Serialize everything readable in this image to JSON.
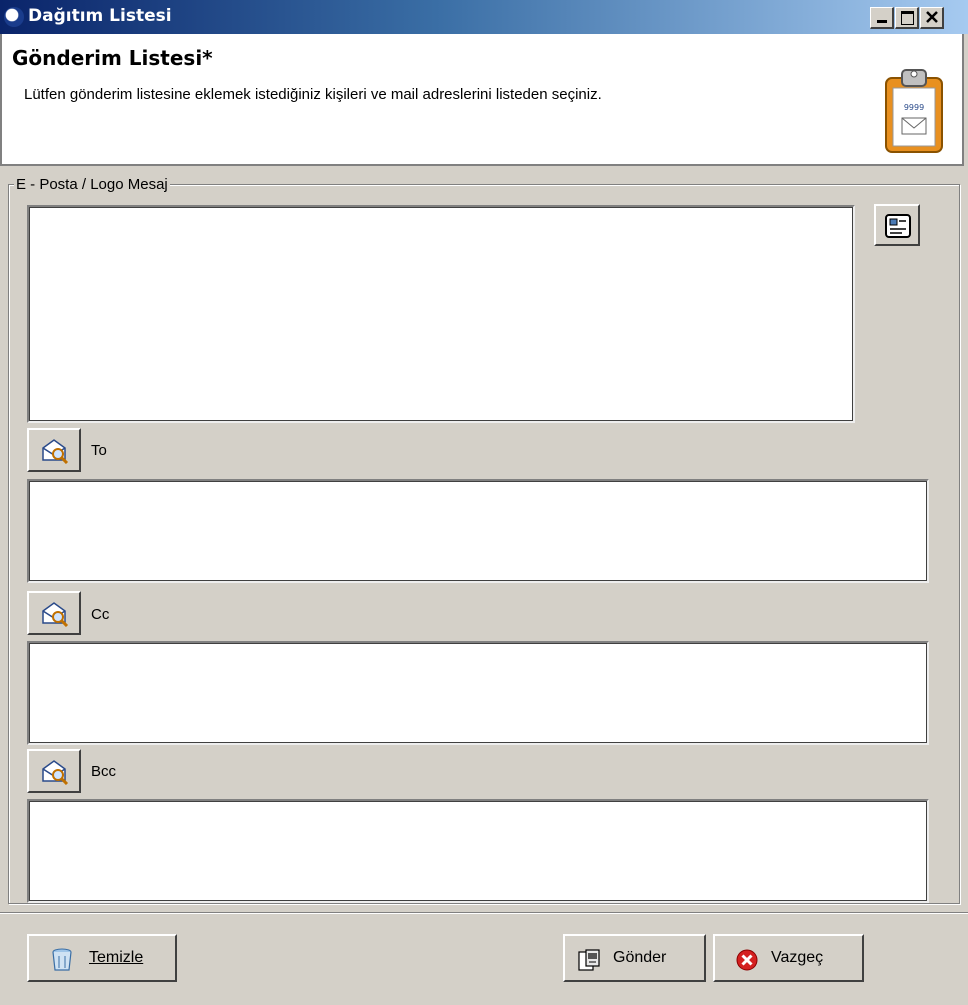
{
  "window": {
    "title": "Dağıtım Listesi"
  },
  "header": {
    "title": "Gönderim Listesi*",
    "subtitle": "Lütfen gönderim listesine eklemek istediğiniz kişileri ve mail adreslerini  listeden seçiniz."
  },
  "group": {
    "legend": "E - Posta / Logo Mesaj"
  },
  "fields": {
    "message": "",
    "to_label": "To",
    "to": "",
    "cc_label": "Cc",
    "cc": "",
    "bcc_label": "Bcc",
    "bcc": ""
  },
  "footer": {
    "clear_label": "Temizle",
    "send_label": "Gönder",
    "cancel_label": "Vazgeç"
  },
  "icons": {
    "window": "app-eye-icon",
    "header": "clipboard-mail-icon",
    "template": "template-document-icon",
    "address_book": "address-book-search-icon",
    "clear": "recycle-bin-icon",
    "send": "send-document-icon",
    "cancel": "red-cancel-icon"
  },
  "colors": {
    "titlebar_start": "#0a246a",
    "titlebar_end": "#a6caf0",
    "face": "#d4d0c8",
    "cancel_red": "#d42020",
    "clipboard_orange": "#e89020"
  }
}
